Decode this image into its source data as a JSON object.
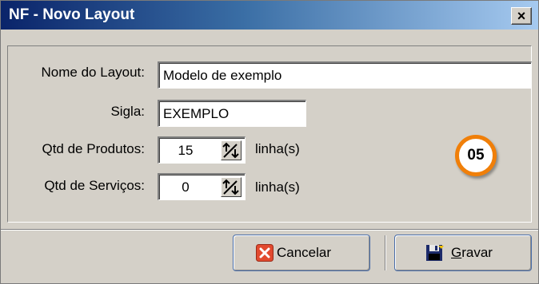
{
  "window": {
    "title": "NF - Novo Layout",
    "close_label": "×"
  },
  "form": {
    "nome_label": "Nome do Layout:",
    "nome_value": "Modelo de exemplo",
    "sigla_label": "Sigla:",
    "sigla_value": "EXEMPLO",
    "produtos_label": "Qtd de Produtos:",
    "produtos_value": "15",
    "produtos_unit": "linha(s)",
    "servicos_label": "Qtd de Serviços:",
    "servicos_value": "0",
    "servicos_unit": "linha(s)"
  },
  "annotation": {
    "badge": "05"
  },
  "buttons": {
    "cancel_label": "Cancelar",
    "save_label": "Gravar",
    "save_mnemonic": "G",
    "save_rest": "ravar"
  },
  "icons": {
    "close": "close-icon",
    "spin": "spin-updown-icon",
    "cancel": "cancel-x-icon",
    "save": "floppy-disk-icon"
  },
  "colors": {
    "title_start": "#0a246a",
    "title_end": "#a6caf0",
    "face": "#d4d0c8",
    "badge_ring": "#f07f09",
    "cancel_icon": "#e24a2f"
  }
}
